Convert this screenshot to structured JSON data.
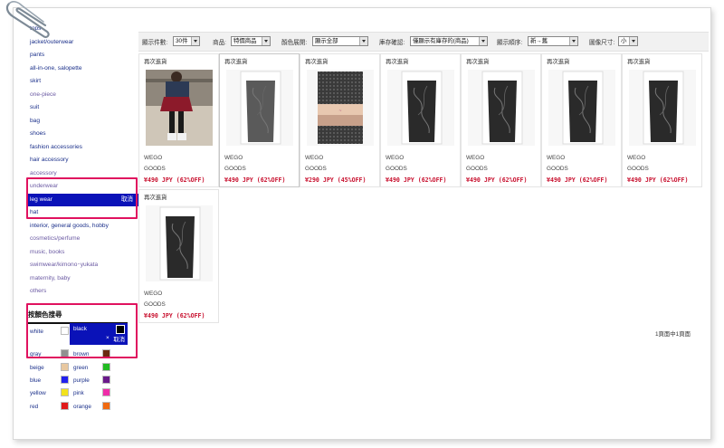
{
  "sidebar": {
    "categories": [
      {
        "label": "tops",
        "muted": false
      },
      {
        "label": "jacket/outerwear",
        "muted": false
      },
      {
        "label": "pants",
        "muted": false
      },
      {
        "label": "all-in-one, salopette",
        "muted": false
      },
      {
        "label": "skirt",
        "muted": false
      },
      {
        "label": "one-piece",
        "muted": true
      },
      {
        "label": "suit",
        "muted": false
      },
      {
        "label": "bag",
        "muted": false
      },
      {
        "label": "shoes",
        "muted": false
      },
      {
        "label": "fashion accessories",
        "muted": false
      },
      {
        "label": "hair accessory",
        "muted": false
      },
      {
        "label": "accessory",
        "muted": true
      },
      {
        "label": "underwear",
        "muted": true
      },
      {
        "label": "leg wear",
        "muted": false,
        "selected": true
      },
      {
        "label": "hat",
        "muted": false
      },
      {
        "label": "interior, general goods, hobby",
        "muted": false
      },
      {
        "label": "cosmetics/perfume",
        "muted": true
      },
      {
        "label": "music, books",
        "muted": true
      },
      {
        "label": "swimwear/kimono･yukata",
        "muted": true
      },
      {
        "label": "maternity, baby",
        "muted": true
      },
      {
        "label": "others",
        "muted": true
      }
    ],
    "cancel_label": "取消",
    "color_search_title": "按顏色搜尋",
    "selected_color": "black",
    "colors": [
      {
        "left": "white",
        "left_color": "#ffffff",
        "right": "black",
        "right_color": "#000000"
      },
      {
        "left": "gray",
        "left_color": "#909090",
        "right": "brown",
        "right_color": "#6b2a10"
      },
      {
        "left": "beige",
        "left_color": "#e8c8a0",
        "right": "green",
        "right_color": "#22bb22"
      },
      {
        "left": "blue",
        "left_color": "#2020ee",
        "right": "purple",
        "right_color": "#6a1a8a"
      },
      {
        "left": "yellow",
        "left_color": "#f2e21c",
        "right": "pink",
        "right_color": "#ef2ca8"
      },
      {
        "left": "red",
        "left_color": "#e01a1a",
        "right": "orange",
        "right_color": "#f06a10"
      }
    ]
  },
  "toolbar": {
    "count_label": "顯示件數:",
    "count_value": "30件",
    "product_label": "商品:",
    "product_value": "特價商品",
    "color_label": "顏色展開:",
    "color_value": "顯示全部",
    "stock_label": "庫存確認:",
    "stock_value": "僅顯示有庫存的(商品)",
    "order_label": "顯示順序:",
    "order_value": "新→舊",
    "size_label": "圖像尺寸:",
    "size_value": "小"
  },
  "products": [
    {
      "restock": "再次進貨",
      "brand": "WEGO",
      "category": "GOODS",
      "price": "¥490 JPY (62%OFF)",
      "photo": "model"
    },
    {
      "restock": "再次進貨",
      "brand": "WEGO",
      "category": "GOODS",
      "price": "¥490 JPY (62%OFF)",
      "photo": "package-pattern"
    },
    {
      "restock": "再次進貨",
      "brand": "WEGO",
      "category": "GOODS",
      "price": "¥290 JPY (45%OFF)",
      "photo": "tights-dots"
    },
    {
      "restock": "再次進貨",
      "brand": "WEGO",
      "category": "GOODS",
      "price": "¥490 JPY (62%OFF)",
      "photo": "package-black"
    },
    {
      "restock": "再次進貨",
      "brand": "WEGO",
      "category": "GOODS",
      "price": "¥490 JPY (62%OFF)",
      "photo": "package-black"
    },
    {
      "restock": "再次進貨",
      "brand": "WEGO",
      "category": "GOODS",
      "price": "¥490 JPY (62%OFF)",
      "photo": "package-black"
    },
    {
      "restock": "再次進貨",
      "brand": "WEGO",
      "category": "GOODS",
      "price": "¥490 JPY (62%OFF)",
      "photo": "package-black"
    },
    {
      "restock": "再次進貨",
      "brand": "WEGO",
      "category": "GOODS",
      "price": "¥490 JPY (62%OFF)",
      "photo": "package-black"
    }
  ],
  "pagination": "1頁面中1頁面",
  "accent_selected": "#0a12b8",
  "highlight_color": "#e0125f",
  "price_color": "#c8102e"
}
